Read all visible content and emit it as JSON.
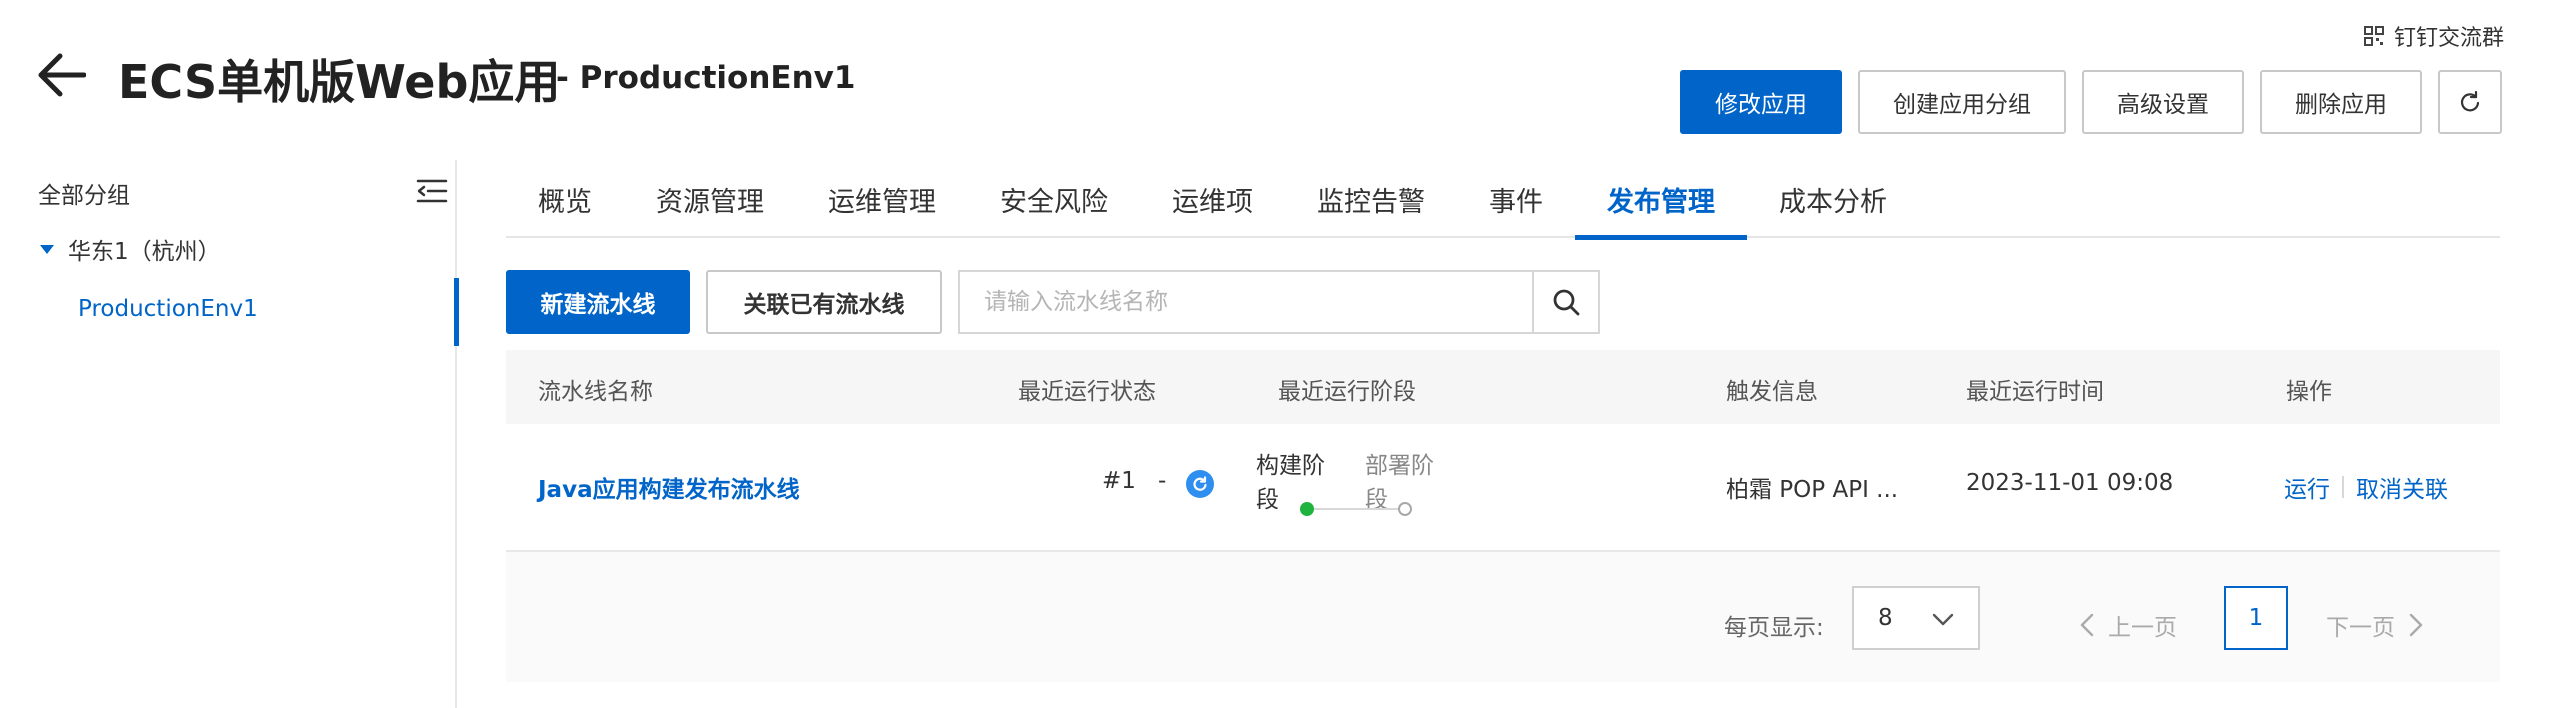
{
  "colors": {
    "primary": "#0064c8",
    "success": "#1fb33f",
    "running": "#2f8ff0"
  },
  "dingtalk": {
    "label": "钉钉交流群",
    "icon": "qrcode-icon"
  },
  "header": {
    "title": "ECS单机版Web应用",
    "subtitle": "- ProductionEnv1",
    "back_icon": "arrow-left-icon"
  },
  "top_actions": {
    "modify": "修改应用",
    "create_group": "创建应用分组",
    "advanced": "高级设置",
    "delete": "删除应用",
    "refresh_icon": "refresh-icon"
  },
  "sidebar": {
    "title": "全部分组",
    "region": "华东1（杭州）",
    "env": "ProductionEnv1"
  },
  "tabs": [
    {
      "label": "概览"
    },
    {
      "label": "资源管理"
    },
    {
      "label": "运维管理"
    },
    {
      "label": "安全风险"
    },
    {
      "label": "运维项"
    },
    {
      "label": "监控告警"
    },
    {
      "label": "事件"
    },
    {
      "label": "发布管理",
      "active": true
    },
    {
      "label": "成本分析"
    }
  ],
  "toolbar": {
    "new_pipeline": "新建流水线",
    "link_pipeline": "关联已有流水线",
    "search_placeholder": "请输入流水线名称"
  },
  "table": {
    "columns": [
      "流水线名称",
      "最近运行状态",
      "最近运行阶段",
      "触发信息",
      "最近运行时间",
      "操作"
    ],
    "rows": [
      {
        "name": "Java应用构建发布流水线",
        "run_no": "#1",
        "dash": "-",
        "stage_done": "构建阶段",
        "stage_todo": "部署阶段",
        "trigger": "柏霜 POP API ...",
        "time": "2023-11-01 09:08",
        "op_run": "运行",
        "op_unlink": "取消关联"
      }
    ]
  },
  "pagination": {
    "page_size_label": "每页显示:",
    "page_size": "8",
    "prev": "上一页",
    "current": "1",
    "next": "下一页"
  }
}
